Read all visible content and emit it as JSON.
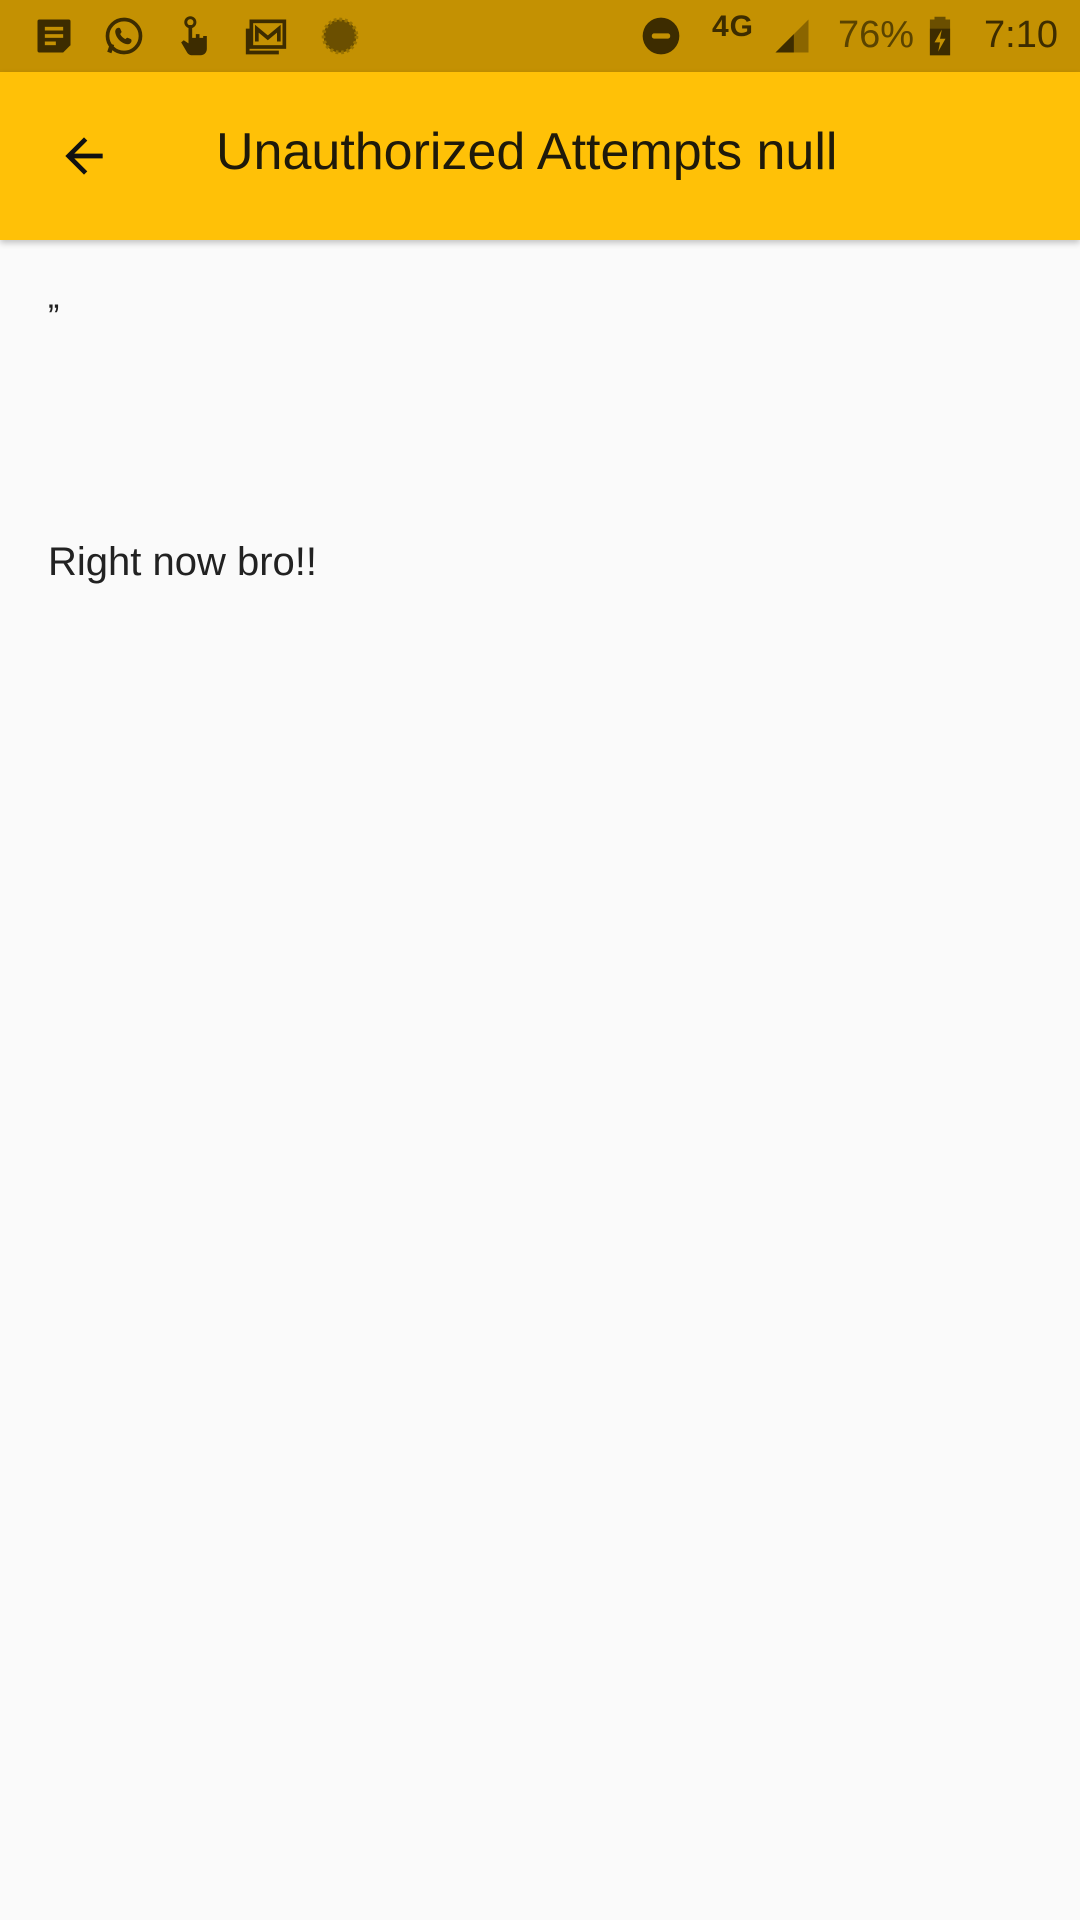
{
  "status_bar": {
    "left_icons": [
      "notes-icon",
      "whatsapp-icon",
      "touch-hand-icon",
      "gmail-icon",
      "sync-loader-icon"
    ],
    "right_icons": [
      "do-not-disturb-icon",
      "cell-signal-icon",
      "battery-charging-icon"
    ],
    "network": "4G",
    "battery_percent": "76%",
    "time": "7:10",
    "color": "#c49102"
  },
  "app_bar": {
    "title": "Unauthorized Attempts null",
    "back_icon": "arrow-back-icon",
    "color": "#ffc107"
  },
  "content": {
    "quote": "”",
    "message": "Right now bro!!"
  }
}
